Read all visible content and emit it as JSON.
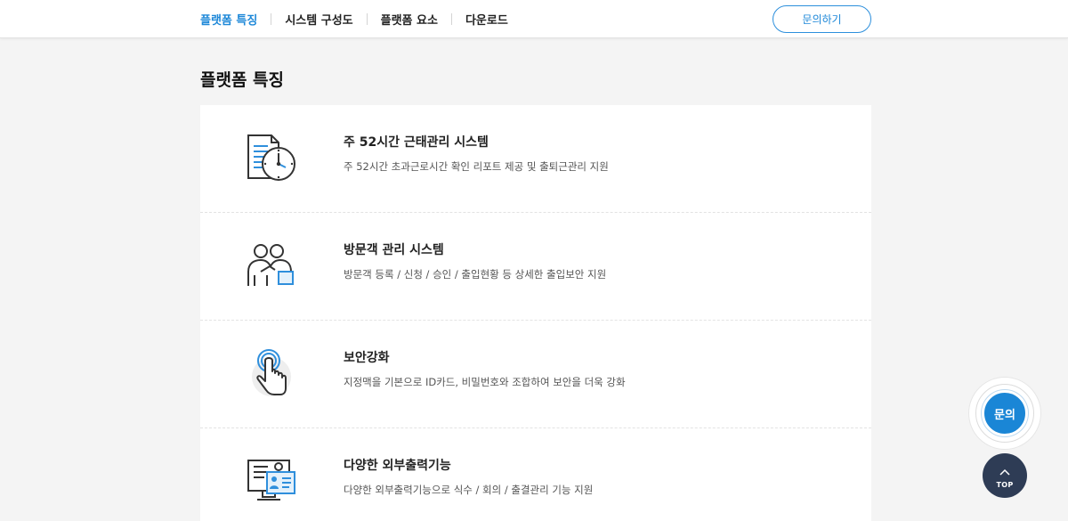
{
  "nav": {
    "items": [
      {
        "label": "플랫폼 특징",
        "active": true
      },
      {
        "label": "시스템 구성도",
        "active": false
      },
      {
        "label": "플랫폼 요소",
        "active": false
      },
      {
        "label": "다운로드",
        "active": false
      }
    ],
    "contact_label": "문의하기"
  },
  "page_title": "플랫폼 특징",
  "features": [
    {
      "icon": "document-clock-icon",
      "title": "주 52시간 근태관리 시스템",
      "desc": "주 52시간 초과근로시간 확인 리포트 제공 및 출퇴근관리 지원"
    },
    {
      "icon": "visitors-icon",
      "title": "방문객 관리 시스템",
      "desc": "방문객 등록 / 신청 / 승인 / 출입현황 등 상세한 출입보안 지원"
    },
    {
      "icon": "touch-finger-icon",
      "title": "보안강화",
      "desc": "지정맥을 기본으로 ID카드, 비밀번호와 조합하여 보안을 더욱 강화"
    },
    {
      "icon": "monitor-id-card-icon",
      "title": "다양한 외부출력기능",
      "desc": "다양한 외부출력기능으로 식수 / 회의 / 출결관리 기능 지원"
    }
  ],
  "floating": {
    "inquiry_label": "문의",
    "top_label": "TOP"
  },
  "colors": {
    "accent": "#1e88d8",
    "dark_button": "#2e3c55",
    "background": "#f4f4f4"
  }
}
